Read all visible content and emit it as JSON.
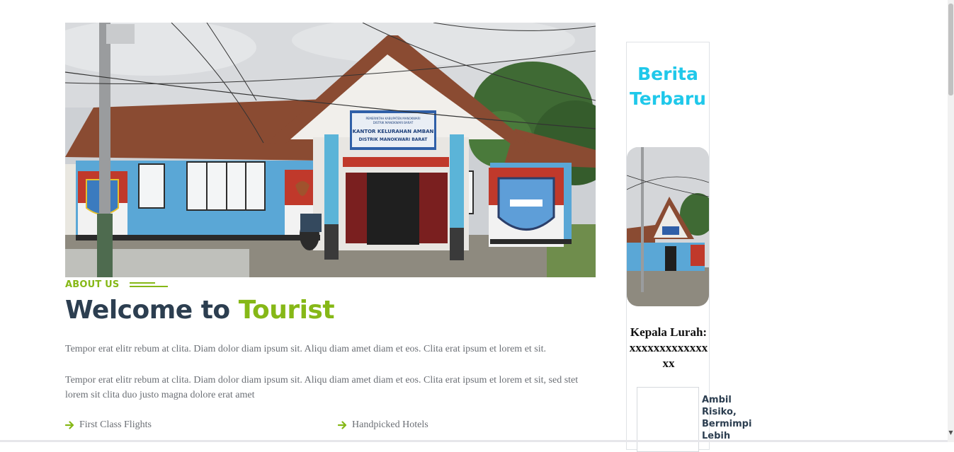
{
  "hero": {
    "sign_line1": "PEMERINTAH KABUPATEN MANOKWARI",
    "sign_line2": "DISTRIK MANOKWARI BARAT",
    "sign_title1": "KANTOR KELURAHAN AMBAN",
    "sign_title2": "DISTRIK MANOKWARI BARAT"
  },
  "about": {
    "label": "ABOUT US",
    "heading_prefix": "Welcome to",
    "heading_accent": "Tourist",
    "paragraph1": "Tempor erat elitr rebum at clita. Diam dolor diam ipsum sit. Aliqu diam amet diam et eos. Clita erat ipsum et lorem et sit.",
    "paragraph2": "Tempor erat elitr rebum at clita. Diam dolor diam ipsum sit. Aliqu diam amet diam et eos. Clita erat ipsum et lorem et sit, sed stet lorem sit clita duo justo magna dolore erat amet",
    "features": [
      "First Class Flights",
      "Handpicked Hotels"
    ]
  },
  "sidebar": {
    "title": "Berita Terbaru",
    "lurah": "Kepala Lurah: xxxxxxxxxxxxxxx",
    "news_title": "Ambil Risiko, Bermimpi Lebih"
  },
  "colors": {
    "accent_green": "#86b817",
    "accent_cyan": "#1fc8ea",
    "heading_dark": "#2c3e50",
    "body_text": "#6b6f75"
  },
  "icons": {
    "feature": "arrow-right-icon",
    "scroll": "scroll-down-arrow-icon"
  }
}
